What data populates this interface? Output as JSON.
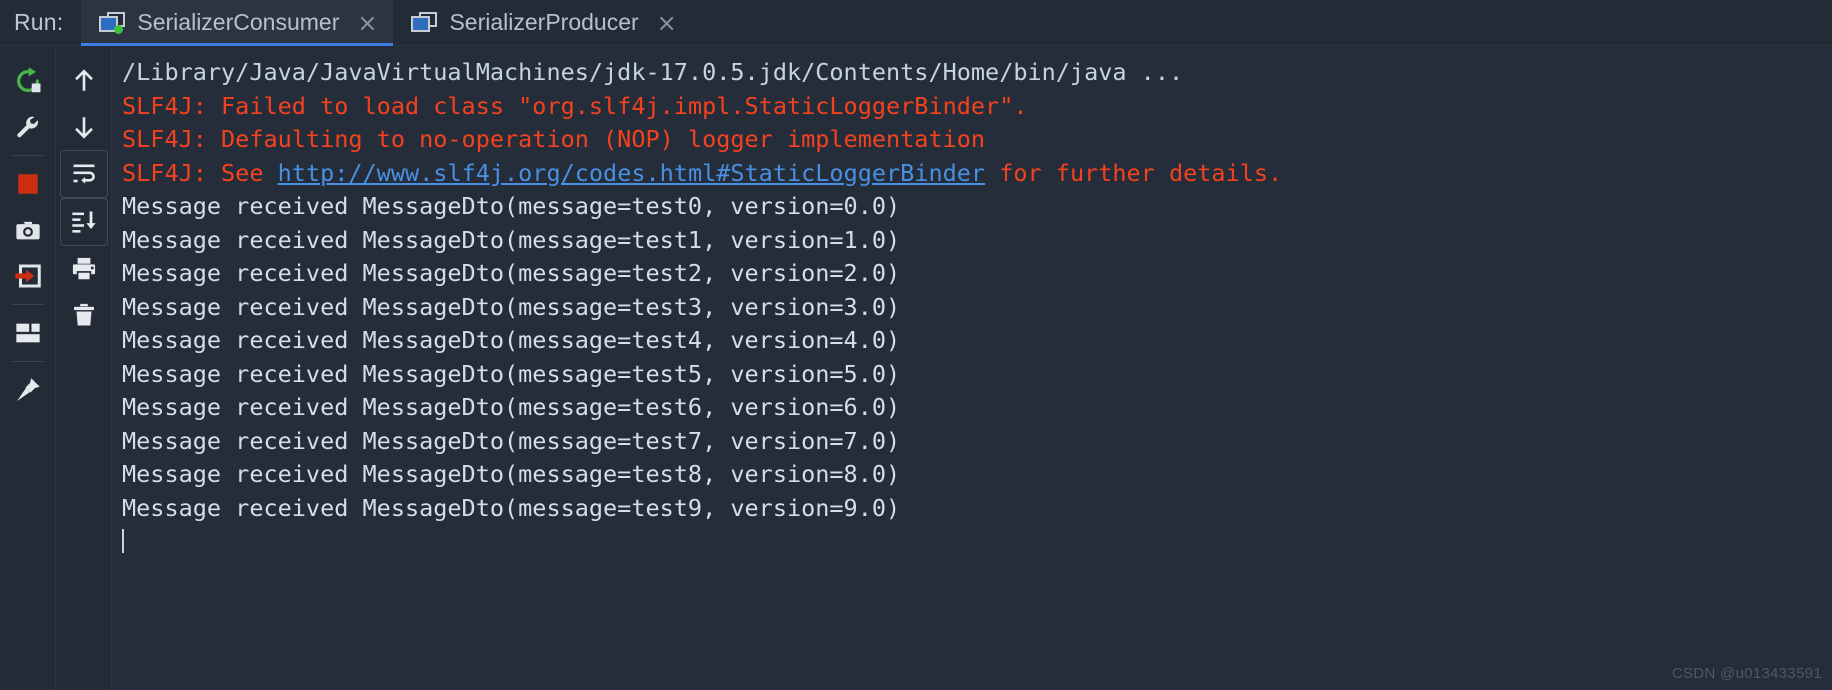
{
  "window": {
    "run_label": "Run:",
    "watermark": "CSDN @u013433591"
  },
  "tabs": [
    {
      "label": "SerializerConsumer",
      "close": "×",
      "active": true,
      "icon": "run-configuration-icon",
      "running_dot": true
    },
    {
      "label": "SerializerProducer",
      "close": "×",
      "active": false,
      "icon": "run-configuration-icon",
      "running_dot": false
    }
  ],
  "left_toolbar": {
    "items": [
      {
        "name": "rerun-icon",
        "title": "Rerun"
      },
      {
        "name": "wrench-icon",
        "title": "Edit Configuration"
      },
      {
        "name": "separator-1",
        "title": ""
      },
      {
        "name": "stop-icon",
        "title": "Stop"
      },
      {
        "name": "camera-icon",
        "title": "Dump Threads"
      },
      {
        "name": "resume-program-icon",
        "title": "Resume Program"
      },
      {
        "name": "separator-2",
        "title": ""
      },
      {
        "name": "layout-icon",
        "title": "Layout Settings"
      },
      {
        "name": "separator-3",
        "title": ""
      },
      {
        "name": "pin-icon",
        "title": "Pin Tab"
      }
    ]
  },
  "console_toolbar": {
    "items": [
      {
        "name": "arrow-up-icon",
        "title": "Up the Stack Trace"
      },
      {
        "name": "arrow-down-icon",
        "title": "Down the Stack Trace"
      },
      {
        "name": "soft-wrap-icon",
        "title": "Soft-Wrap",
        "boxed": true
      },
      {
        "name": "scroll-to-end-icon",
        "title": "Scroll to the End",
        "boxed": true
      },
      {
        "name": "print-icon",
        "title": "Print"
      },
      {
        "name": "trash-icon",
        "title": "Clear All"
      }
    ]
  },
  "console": {
    "lines": [
      {
        "type": "command",
        "segments": [
          {
            "style": "white",
            "text": "/Library/Java/JavaVirtualMachines/jdk-17.0.5.jdk/Contents/Home/bin/java ..."
          }
        ]
      },
      {
        "type": "stderr",
        "segments": [
          {
            "style": "red",
            "text": "SLF4J: Failed to load class \"org.slf4j.impl.StaticLoggerBinder\"."
          }
        ]
      },
      {
        "type": "stderr",
        "segments": [
          {
            "style": "red",
            "text": "SLF4J: Defaulting to no-operation (NOP) logger implementation"
          }
        ]
      },
      {
        "type": "stderr",
        "segments": [
          {
            "style": "red",
            "text": "SLF4J: See "
          },
          {
            "style": "link",
            "text": "http://www.slf4j.org/codes.html#StaticLoggerBinder"
          },
          {
            "style": "red",
            "text": " for further details."
          }
        ]
      },
      {
        "type": "stdout",
        "segments": [
          {
            "style": "out",
            "text": "Message received MessageDto(message=test0, version=0.0)"
          }
        ]
      },
      {
        "type": "stdout",
        "segments": [
          {
            "style": "out",
            "text": "Message received MessageDto(message=test1, version=1.0)"
          }
        ]
      },
      {
        "type": "stdout",
        "segments": [
          {
            "style": "out",
            "text": "Message received MessageDto(message=test2, version=2.0)"
          }
        ]
      },
      {
        "type": "stdout",
        "segments": [
          {
            "style": "out",
            "text": "Message received MessageDto(message=test3, version=3.0)"
          }
        ]
      },
      {
        "type": "stdout",
        "segments": [
          {
            "style": "out",
            "text": "Message received MessageDto(message=test4, version=4.0)"
          }
        ]
      },
      {
        "type": "stdout",
        "segments": [
          {
            "style": "out",
            "text": "Message received MessageDto(message=test5, version=5.0)"
          }
        ]
      },
      {
        "type": "stdout",
        "segments": [
          {
            "style": "out",
            "text": "Message received MessageDto(message=test6, version=6.0)"
          }
        ]
      },
      {
        "type": "stdout",
        "segments": [
          {
            "style": "out",
            "text": "Message received MessageDto(message=test7, version=7.0)"
          }
        ]
      },
      {
        "type": "stdout",
        "segments": [
          {
            "style": "out",
            "text": "Message received MessageDto(message=test8, version=8.0)"
          }
        ]
      },
      {
        "type": "stdout",
        "segments": [
          {
            "style": "out",
            "text": "Message received MessageDto(message=test9, version=9.0)"
          }
        ]
      },
      {
        "type": "caret",
        "segments": []
      }
    ]
  },
  "colors": {
    "background": "#222B36",
    "console_background": "#242D39",
    "tab_active_background": "#2B3440",
    "tab_underline": "#3C7EE6",
    "stderr": "#F5421E",
    "link": "#4A90E2",
    "stdout": "#D5DEE8",
    "command": "#C6D4E2",
    "stop_icon": "#CC2E12",
    "rerun_icon": "#4BB34B",
    "running_dot": "#42C23A"
  }
}
